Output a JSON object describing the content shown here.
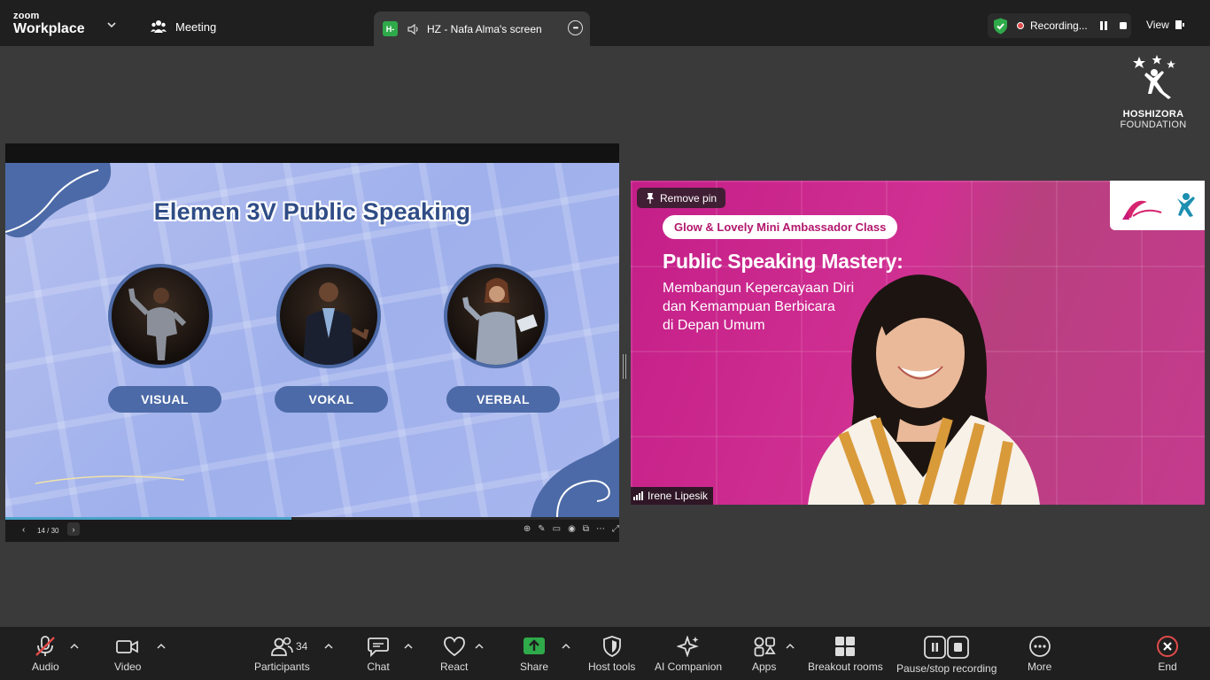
{
  "window": {
    "brand_small": "zoom",
    "brand_large": "Workplace",
    "meeting_label": "Meeting",
    "share_tab_badge": "H-",
    "share_tab_title": "HZ - Nafa Alma's screen",
    "recording_label": "Recording...",
    "view_label": "View"
  },
  "foundation": {
    "name1": "HOSHIZORA",
    "name2": "FOUNDATION"
  },
  "slide": {
    "title": "Elemen 3V Public Speaking",
    "items": [
      "VISUAL",
      "VOKAL",
      "VERBAL"
    ],
    "page": "14 / 30",
    "current_page": 14,
    "total_pages": 30
  },
  "video": {
    "remove_pin_label": "Remove pin",
    "badge": "Glow & Lovely Mini Ambassador Class",
    "title": "Public Speaking Mastery:",
    "subtitle_lines": [
      "Membangun Kepercayaan Diri",
      "dan Kemampuan Berbicara",
      "di Depan Umum"
    ],
    "participant_name": "Irene Lipesik"
  },
  "toolbar": {
    "audio": "Audio",
    "video": "Video",
    "participants": "Participants",
    "participants_count": "34",
    "chat": "Chat",
    "react": "React",
    "share": "Share",
    "host_tools": "Host tools",
    "ai_companion": "AI Companion",
    "apps": "Apps",
    "breakout_rooms": "Breakout rooms",
    "pause_stop_recording": "Pause/stop recording",
    "more": "More",
    "end": "End"
  },
  "colors": {
    "share_green": "#2faa4a",
    "end_red": "#e24b4b",
    "slide_navy": "#4c6aa7",
    "video_magenta": "#c41e88",
    "shield_green": "#2faa4a"
  }
}
